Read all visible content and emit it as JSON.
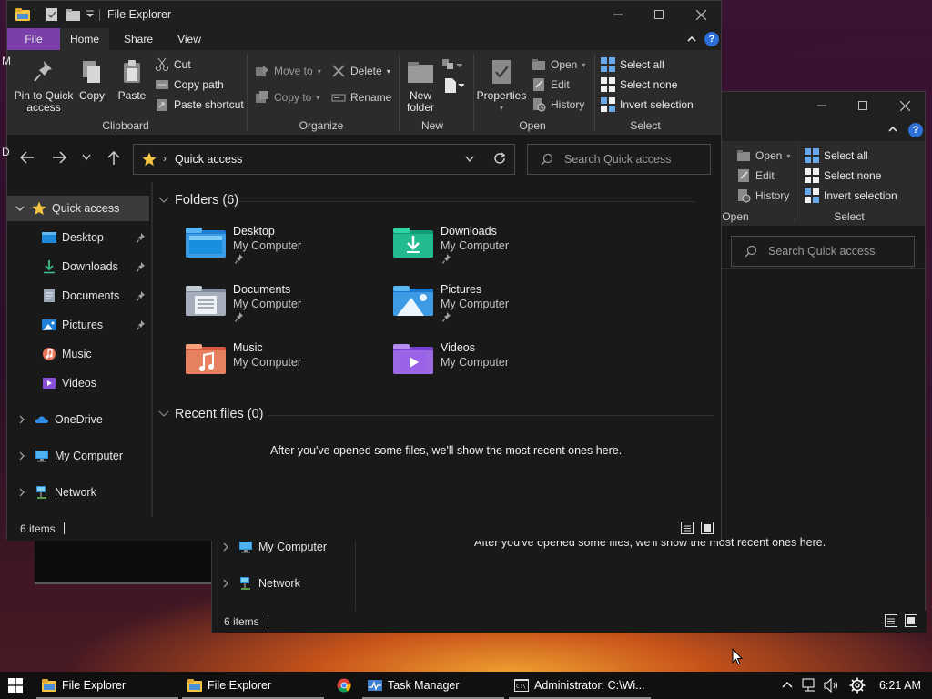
{
  "colors": {
    "accent": "#7a3fa8",
    "select_bg": "#3a3a3a",
    "window_bg": "#191919",
    "ribbon_bg": "#2b2b2b"
  },
  "back_window": {
    "ribbon": {
      "open_items": [
        {
          "label": "Open",
          "icon": "open-icon"
        },
        {
          "label": "Edit",
          "icon": "edit-icon"
        },
        {
          "label": "History",
          "icon": "history-icon"
        }
      ],
      "select_items": [
        {
          "label": "Select all",
          "icon": "select-all-icon"
        },
        {
          "label": "Select none",
          "icon": "select-none-icon"
        },
        {
          "label": "Invert selection",
          "icon": "invert-selection-icon"
        }
      ],
      "partial_text": "es",
      "group_open": "Open",
      "group_select": "Select"
    },
    "search_placeholder": "Search Quick access",
    "empty_text": "After you've opened some files, we'll show the most recent ones here.",
    "sidebar": [
      {
        "label": "My Computer",
        "icon": "computer-icon"
      },
      {
        "label": "Network",
        "icon": "network-icon"
      }
    ],
    "status": "6 items"
  },
  "window": {
    "title": "File Explorer",
    "menu_tabs": [
      "File",
      "Home",
      "Share",
      "View"
    ],
    "active_tab": "Home",
    "ribbon": {
      "clipboard": {
        "pin": "Pin to Quick access",
        "copy": "Copy",
        "paste": "Paste",
        "cut": "Cut",
        "copy_path": "Copy path",
        "paste_shortcut": "Paste shortcut",
        "label": "Clipboard"
      },
      "organize": {
        "move_to": "Move to",
        "copy_to": "Copy to",
        "delete": "Delete",
        "rename": "Rename",
        "label": "Organize"
      },
      "new": {
        "new_folder": "New folder",
        "label": "New"
      },
      "open": {
        "properties": "Properties",
        "open": "Open",
        "edit": "Edit",
        "history": "History",
        "label": "Open"
      },
      "select": {
        "select_all": "Select all",
        "select_none": "Select none",
        "invert": "Invert selection",
        "label": "Select"
      }
    },
    "address": {
      "path": "Quick access",
      "search_placeholder": "Search Quick access"
    },
    "sidebar": {
      "quick_access": "Quick access",
      "quick_items": [
        {
          "label": "Desktop",
          "icon": "desktop-folder-icon",
          "pinned": true
        },
        {
          "label": "Downloads",
          "icon": "downloads-icon",
          "pinned": true
        },
        {
          "label": "Documents",
          "icon": "documents-icon",
          "pinned": true
        },
        {
          "label": "Pictures",
          "icon": "pictures-icon",
          "pinned": true
        },
        {
          "label": "Music",
          "icon": "music-icon",
          "pinned": false
        },
        {
          "label": "Videos",
          "icon": "videos-icon",
          "pinned": false
        }
      ],
      "roots": [
        {
          "label": "OneDrive",
          "icon": "onedrive-icon"
        },
        {
          "label": "My Computer",
          "icon": "computer-icon"
        },
        {
          "label": "Network",
          "icon": "network-icon"
        }
      ]
    },
    "folders_header": "Folders (6)",
    "folders": [
      {
        "name": "Desktop",
        "location": "My Computer",
        "icon": "desktop-folder-icon",
        "pinned": true
      },
      {
        "name": "Downloads",
        "location": "My Computer",
        "icon": "downloads-folder-icon",
        "pinned": true
      },
      {
        "name": "Documents",
        "location": "My Computer",
        "icon": "documents-folder-icon",
        "pinned": true
      },
      {
        "name": "Pictures",
        "location": "My Computer",
        "icon": "pictures-folder-icon",
        "pinned": true
      },
      {
        "name": "Music",
        "location": "My Computer",
        "icon": "music-folder-icon",
        "pinned": false
      },
      {
        "name": "Videos",
        "location": "My Computer",
        "icon": "videos-folder-icon",
        "pinned": false
      }
    ],
    "recent_header": "Recent files (0)",
    "recent_empty": "After you've opened some files, we'll show the most recent ones here.",
    "status": "6 items"
  },
  "taskbar": {
    "items": [
      {
        "label": "File Explorer",
        "icon": "file-explorer-icon",
        "active": true
      },
      {
        "label": "File Explorer",
        "icon": "file-explorer-icon",
        "active": true
      },
      {
        "label": "",
        "icon": "chrome-icon",
        "active": false
      },
      {
        "label": "Task Manager",
        "icon": "task-manager-icon",
        "active": true
      },
      {
        "label": "Administrator: C:\\Wi...",
        "icon": "cmd-icon",
        "active": true
      }
    ],
    "clock": "6:21 AM"
  }
}
